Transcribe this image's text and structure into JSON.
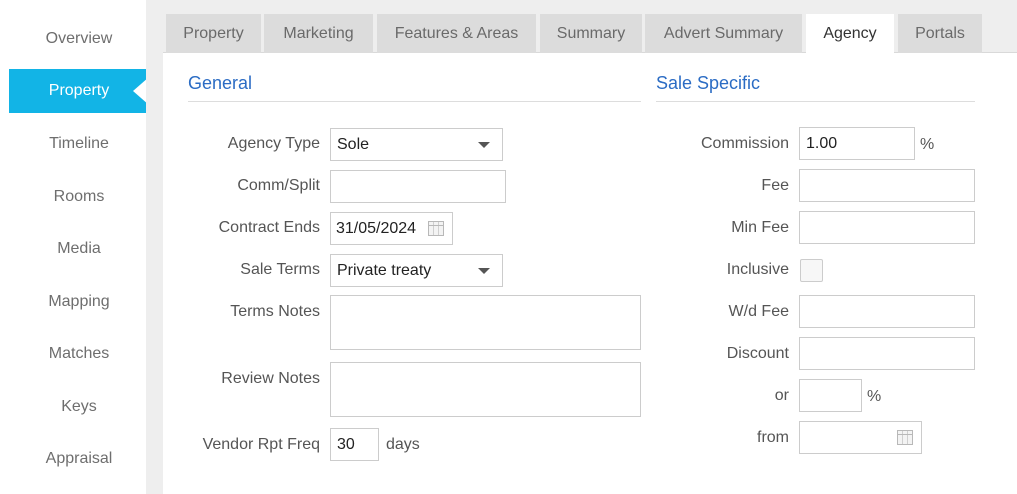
{
  "sidebar": {
    "items": [
      {
        "label": "Overview"
      },
      {
        "label": "Property"
      },
      {
        "label": "Timeline"
      },
      {
        "label": "Rooms"
      },
      {
        "label": "Media"
      },
      {
        "label": "Mapping"
      },
      {
        "label": "Matches"
      },
      {
        "label": "Keys"
      },
      {
        "label": "Appraisal"
      }
    ],
    "active_index": 1
  },
  "tabs": [
    {
      "label": "Property"
    },
    {
      "label": "Marketing"
    },
    {
      "label": "Features & Areas"
    },
    {
      "label": "Summary"
    },
    {
      "label": "Advert Summary"
    },
    {
      "label": "Agency"
    },
    {
      "label": "Portals"
    }
  ],
  "active_tab_index": 5,
  "general": {
    "title": "General",
    "agency_type": {
      "label": "Agency Type",
      "value": "Sole"
    },
    "comm_split": {
      "label": "Comm/Split",
      "value": ""
    },
    "contract_ends": {
      "label": "Contract Ends",
      "value": "31/05/2024"
    },
    "sale_terms": {
      "label": "Sale Terms",
      "value": "Private treaty"
    },
    "terms_notes": {
      "label": "Terms Notes",
      "value": ""
    },
    "review_notes": {
      "label": "Review Notes",
      "value": ""
    },
    "vendor_rpt_freq": {
      "label": "Vendor Rpt Freq",
      "value": "30",
      "unit": "days"
    }
  },
  "sale_specific": {
    "title": "Sale Specific",
    "commission": {
      "label": "Commission",
      "value": "1.00",
      "unit": "%"
    },
    "fee": {
      "label": "Fee",
      "value": ""
    },
    "min_fee": {
      "label": "Min Fee",
      "value": ""
    },
    "inclusive": {
      "label": "Inclusive",
      "checked": false
    },
    "wd_fee": {
      "label": "W/d Fee",
      "value": ""
    },
    "discount": {
      "label": "Discount",
      "value": ""
    },
    "or": {
      "label": "or",
      "value": "",
      "unit": "%"
    },
    "from": {
      "label": "from",
      "value": ""
    }
  },
  "colors": {
    "accent": "#12b4e6",
    "section_title": "#2b6cc4"
  }
}
